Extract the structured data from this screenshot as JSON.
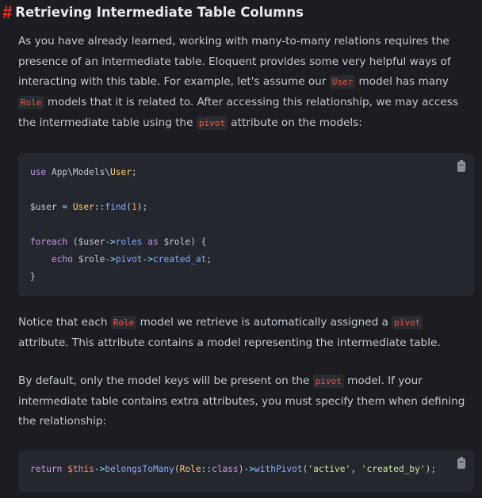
{
  "heading": {
    "hash": "#",
    "title": "Retrieving Intermediate Table Columns"
  },
  "para1": {
    "t1": "As you have already learned, working with many-to-many relations requires the presence of an intermediate table. Eloquent provides some very helpful ways of interacting with this table. For example, let's assume our ",
    "c1": "User",
    "t2": " model has many ",
    "c2": "Role",
    "t3": " models that it is related to. After accessing this relationship, we may access the intermediate table using the ",
    "c3": "pivot",
    "t4": " attribute on the models:"
  },
  "code1": {
    "l1_use": "use",
    "l1_ns": " App\\Models\\",
    "l1_cls": "User",
    "l1_end": ";",
    "l2_var": "$user",
    "l2_eq": " = ",
    "l2_cls": "User",
    "l2_sep": "::",
    "l2_fn": "find",
    "l2_open": "(",
    "l2_num": "1",
    "l2_close": ");",
    "l3_kw": "foreach",
    "l3_a": " ($user",
    "l3_arrow": "->",
    "l3_prop": "roles",
    "l3_as": " as",
    "l3_b": " $role) {",
    "l4_kw": "echo",
    "l4_a": " $role",
    "l4_arrow1": "->",
    "l4_p1": "pivot",
    "l4_arrow2": "->",
    "l4_p2": "created_at",
    "l4_end": ";",
    "l5": "}"
  },
  "para2": {
    "t1": "Notice that each ",
    "c1": "Role",
    "t2": " model we retrieve is automatically assigned a ",
    "c2": "pivot",
    "t3": " attribute. This attribute contains a model representing the intermediate table."
  },
  "para3": {
    "t1": "By default, only the model keys will be present on the ",
    "c1": "pivot",
    "t2": " model. If your intermediate table contains extra attributes, you must specify them when defining the relationship:"
  },
  "code2": {
    "kw": "return",
    "this": " $this",
    "arrow1": "->",
    "fn1": "belongsToMany",
    "open1": "(",
    "cls": "Role",
    "sep": "::",
    "classkw": "class",
    "close1": ")",
    "arrow2": "->",
    "fn2": "withPivot",
    "open2": "(",
    "s1": "'active'",
    "comma": ", ",
    "s2": "'created_by'",
    "close2": ");"
  },
  "icons": {
    "copy": "clipboard-icon"
  },
  "colors": {
    "accent": "#ff2d20",
    "background": "#1b1d22",
    "code_background": "#25272e"
  }
}
